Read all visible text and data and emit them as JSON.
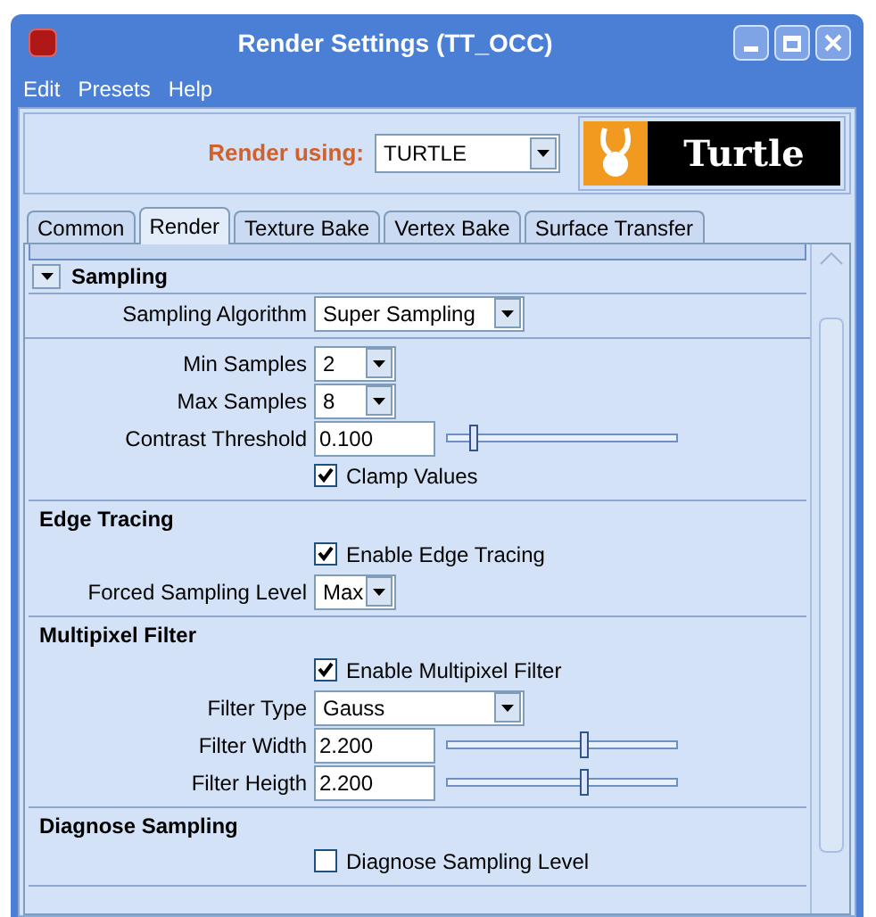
{
  "window": {
    "title": "Render Settings (TT_OCC)"
  },
  "menu": [
    "Edit",
    "Presets",
    "Help"
  ],
  "renderer": {
    "label": "Render using:",
    "value": "TURTLE",
    "logo_text": "Turtle"
  },
  "tabs": [
    {
      "label": "Common",
      "selected": false
    },
    {
      "label": "Render",
      "selected": true
    },
    {
      "label": "Texture Bake",
      "selected": false
    },
    {
      "label": "Vertex Bake",
      "selected": false
    },
    {
      "label": "Surface Transfer",
      "selected": false
    }
  ],
  "sections": [
    {
      "title": "Sampling",
      "expanded": true,
      "rows": [
        {
          "kind": "dropdown",
          "label": "Sampling Algorithm",
          "value": "Super Sampling"
        },
        {
          "kind": "divider"
        },
        {
          "kind": "short_dropdown",
          "label": "Min Samples",
          "value": "2"
        },
        {
          "kind": "short_dropdown",
          "label": "Max Samples",
          "value": "8"
        },
        {
          "kind": "slider",
          "label": "Contrast Threshold",
          "value": "0.100",
          "level": 0.1
        },
        {
          "kind": "checkbox",
          "label": "Clamp Values",
          "checked": true
        }
      ]
    },
    {
      "title": "Edge Tracing",
      "rows": [
        {
          "kind": "checkbox",
          "label": "Enable Edge Tracing",
          "checked": true
        },
        {
          "kind": "short_dropdown",
          "label": "Forced Sampling Level",
          "value": "Max"
        }
      ]
    },
    {
      "title": "Multipixel Filter",
      "rows": [
        {
          "kind": "checkbox",
          "label": "Enable Multipixel Filter",
          "checked": true
        },
        {
          "kind": "dropdown",
          "label": "Filter Type",
          "value": "Gauss"
        },
        {
          "kind": "slider",
          "label": "Filter Width",
          "value": "2.200",
          "level": 0.6
        },
        {
          "kind": "slider",
          "label": "Filter Heigth",
          "value": "2.200",
          "level": 0.6
        }
      ]
    },
    {
      "title": "Diagnose Sampling",
      "rows": [
        {
          "kind": "checkbox",
          "label": "Diagnose Sampling Level",
          "checked": false
        }
      ]
    }
  ]
}
